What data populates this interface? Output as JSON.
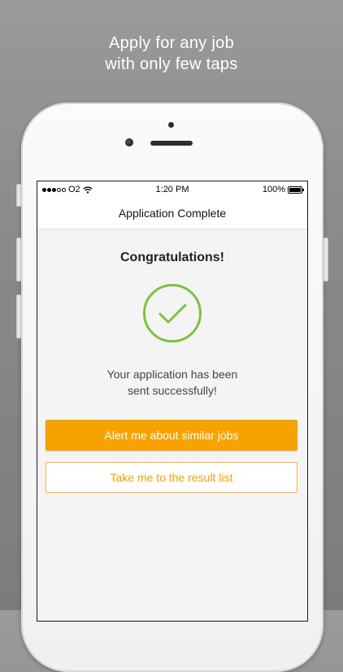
{
  "promo": {
    "line1": "Apply for any job",
    "line2": "with only few taps"
  },
  "status_bar": {
    "carrier": "O2",
    "time": "1:20 PM",
    "battery": "100%",
    "battery_level": 1.0,
    "signal_bars_filled": 3,
    "signal_bars_total": 5
  },
  "nav": {
    "title": "Application Complete"
  },
  "main": {
    "heading": "Congratulations!",
    "success_icon": "checkmark-circle-icon",
    "message_line1": "Your application has been",
    "message_line2": "sent successfully!",
    "primary_button": "Alert me about similar jobs",
    "secondary_button": "Take me to the result list"
  },
  "colors": {
    "accent": "#f8a200",
    "success": "#7dc243"
  }
}
